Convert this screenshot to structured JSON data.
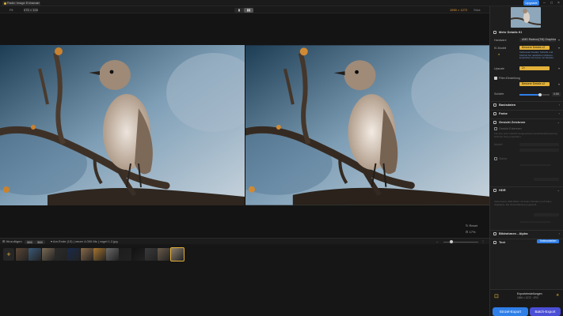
{
  "window": {
    "tab_title": "Radio Image Enhancer",
    "upgrade_label": "Upgrade"
  },
  "toolbar": {
    "fit_label": "Fit",
    "zoom_value": "075 × 100",
    "view_left": "▮",
    "view_right": "▮▮",
    "resolution": "1590 × 1272",
    "right_label": "Stick"
  },
  "viewer": {
    "reset_label": "Reset",
    "zoom_label": "17%"
  },
  "filmstrip": {
    "add_label": "Hinzufügen",
    "count_a": "365",
    "count_b": "365",
    "filter_label": "Am Ende (13)",
    "sort_label": "neuer 4.000 Ms",
    "file_label": "vogel 1.2.jpg",
    "add_icon": "+",
    "thumb_colors": [
      "#5a4636",
      "#3b5a78",
      "#7a6a55",
      "#2b2b2b",
      "#1a2a4a",
      "#8a6a4a",
      "#a5742f",
      "#6a6a6a",
      "#1d1d1d",
      "#121212",
      "#3a3a3a",
      "#6a5a4a",
      "#8d7f6c"
    ]
  },
  "panel": {
    "model_section": "Mehr Details KI",
    "labels": {
      "hardware": "Hardware",
      "ai_model": "KI-Modell",
      "upscale": "Upscale",
      "denoise": "Entrauschen",
      "sharpen": "Schärfe"
    },
    "hardware_value": "AMD Radeon(TM) Graphics",
    "ai_model_value": "Bessere Details v2",
    "ai_model_note": "Verbessert Details, Schärfe und Klarheit bei natürlichen Motiven. Empfohlen für Fotos mit Struktur.",
    "upscale_value": "2×",
    "denoise_check_label": "Filter-Einstellung",
    "denoise_value": "Bessere Details v2",
    "sharpen_value": "0.50",
    "sections": [
      "Basisdaten",
      "Farbe",
      "Gesicht Zeichnen",
      "HDR",
      "Bildrahmen - Alpha",
      "Text"
    ],
    "face_checkbox": "Gesicht Erkennen",
    "face_note": "Für eine sehr natürlich ausgesehene Gesichtsverbesserung. Nicht für Tiere empfohlen.",
    "face_model": "Modell",
    "face_strength": "Stärke",
    "hdr_note": "Verbesserte HDR-Bilder mit tiefen Schatten und hellen Highlights. Bei Überstrahlung eingestellt.",
    "tool_pill": "Textbearbeiten",
    "export_settings": "Exporteinstellungen",
    "export_detail": "1590 × 1272 · JPG",
    "single_export": "Einzel-Export",
    "batch_export": "Batch-Export"
  }
}
